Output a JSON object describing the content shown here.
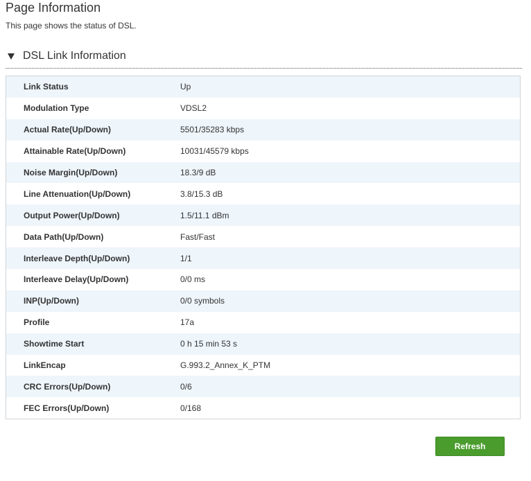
{
  "page": {
    "title": "Page Information",
    "description": "This page shows the status of DSL."
  },
  "section": {
    "title": "DSL Link Information",
    "icon": "triangle-down-icon"
  },
  "rows": [
    {
      "label": "Link Status",
      "value": "Up"
    },
    {
      "label": "Modulation Type",
      "value": "VDSL2"
    },
    {
      "label": "Actual Rate(Up/Down)",
      "value": "5501/35283 kbps"
    },
    {
      "label": "Attainable Rate(Up/Down)",
      "value": "10031/45579 kbps"
    },
    {
      "label": "Noise Margin(Up/Down)",
      "value": "18.3/9 dB"
    },
    {
      "label": "Line Attenuation(Up/Down)",
      "value": "3.8/15.3 dB"
    },
    {
      "label": "Output Power(Up/Down)",
      "value": "1.5/11.1 dBm"
    },
    {
      "label": "Data Path(Up/Down)",
      "value": "Fast/Fast"
    },
    {
      "label": "Interleave Depth(Up/Down)",
      "value": "1/1"
    },
    {
      "label": "Interleave Delay(Up/Down)",
      "value": "0/0 ms"
    },
    {
      "label": "INP(Up/Down)",
      "value": "0/0 symbols"
    },
    {
      "label": "Profile",
      "value": "17a"
    },
    {
      "label": "Showtime Start",
      "value": "0 h 15 min 53 s"
    },
    {
      "label": "LinkEncap",
      "value": "G.993.2_Annex_K_PTM"
    },
    {
      "label": "CRC Errors(Up/Down)",
      "value": "0/6"
    },
    {
      "label": "FEC Errors(Up/Down)",
      "value": "0/168"
    }
  ],
  "actions": {
    "refresh_label": "Refresh"
  },
  "colors": {
    "row_stripe": "#eef5fb",
    "button_green": "#4a9c2d",
    "text": "#333333"
  }
}
